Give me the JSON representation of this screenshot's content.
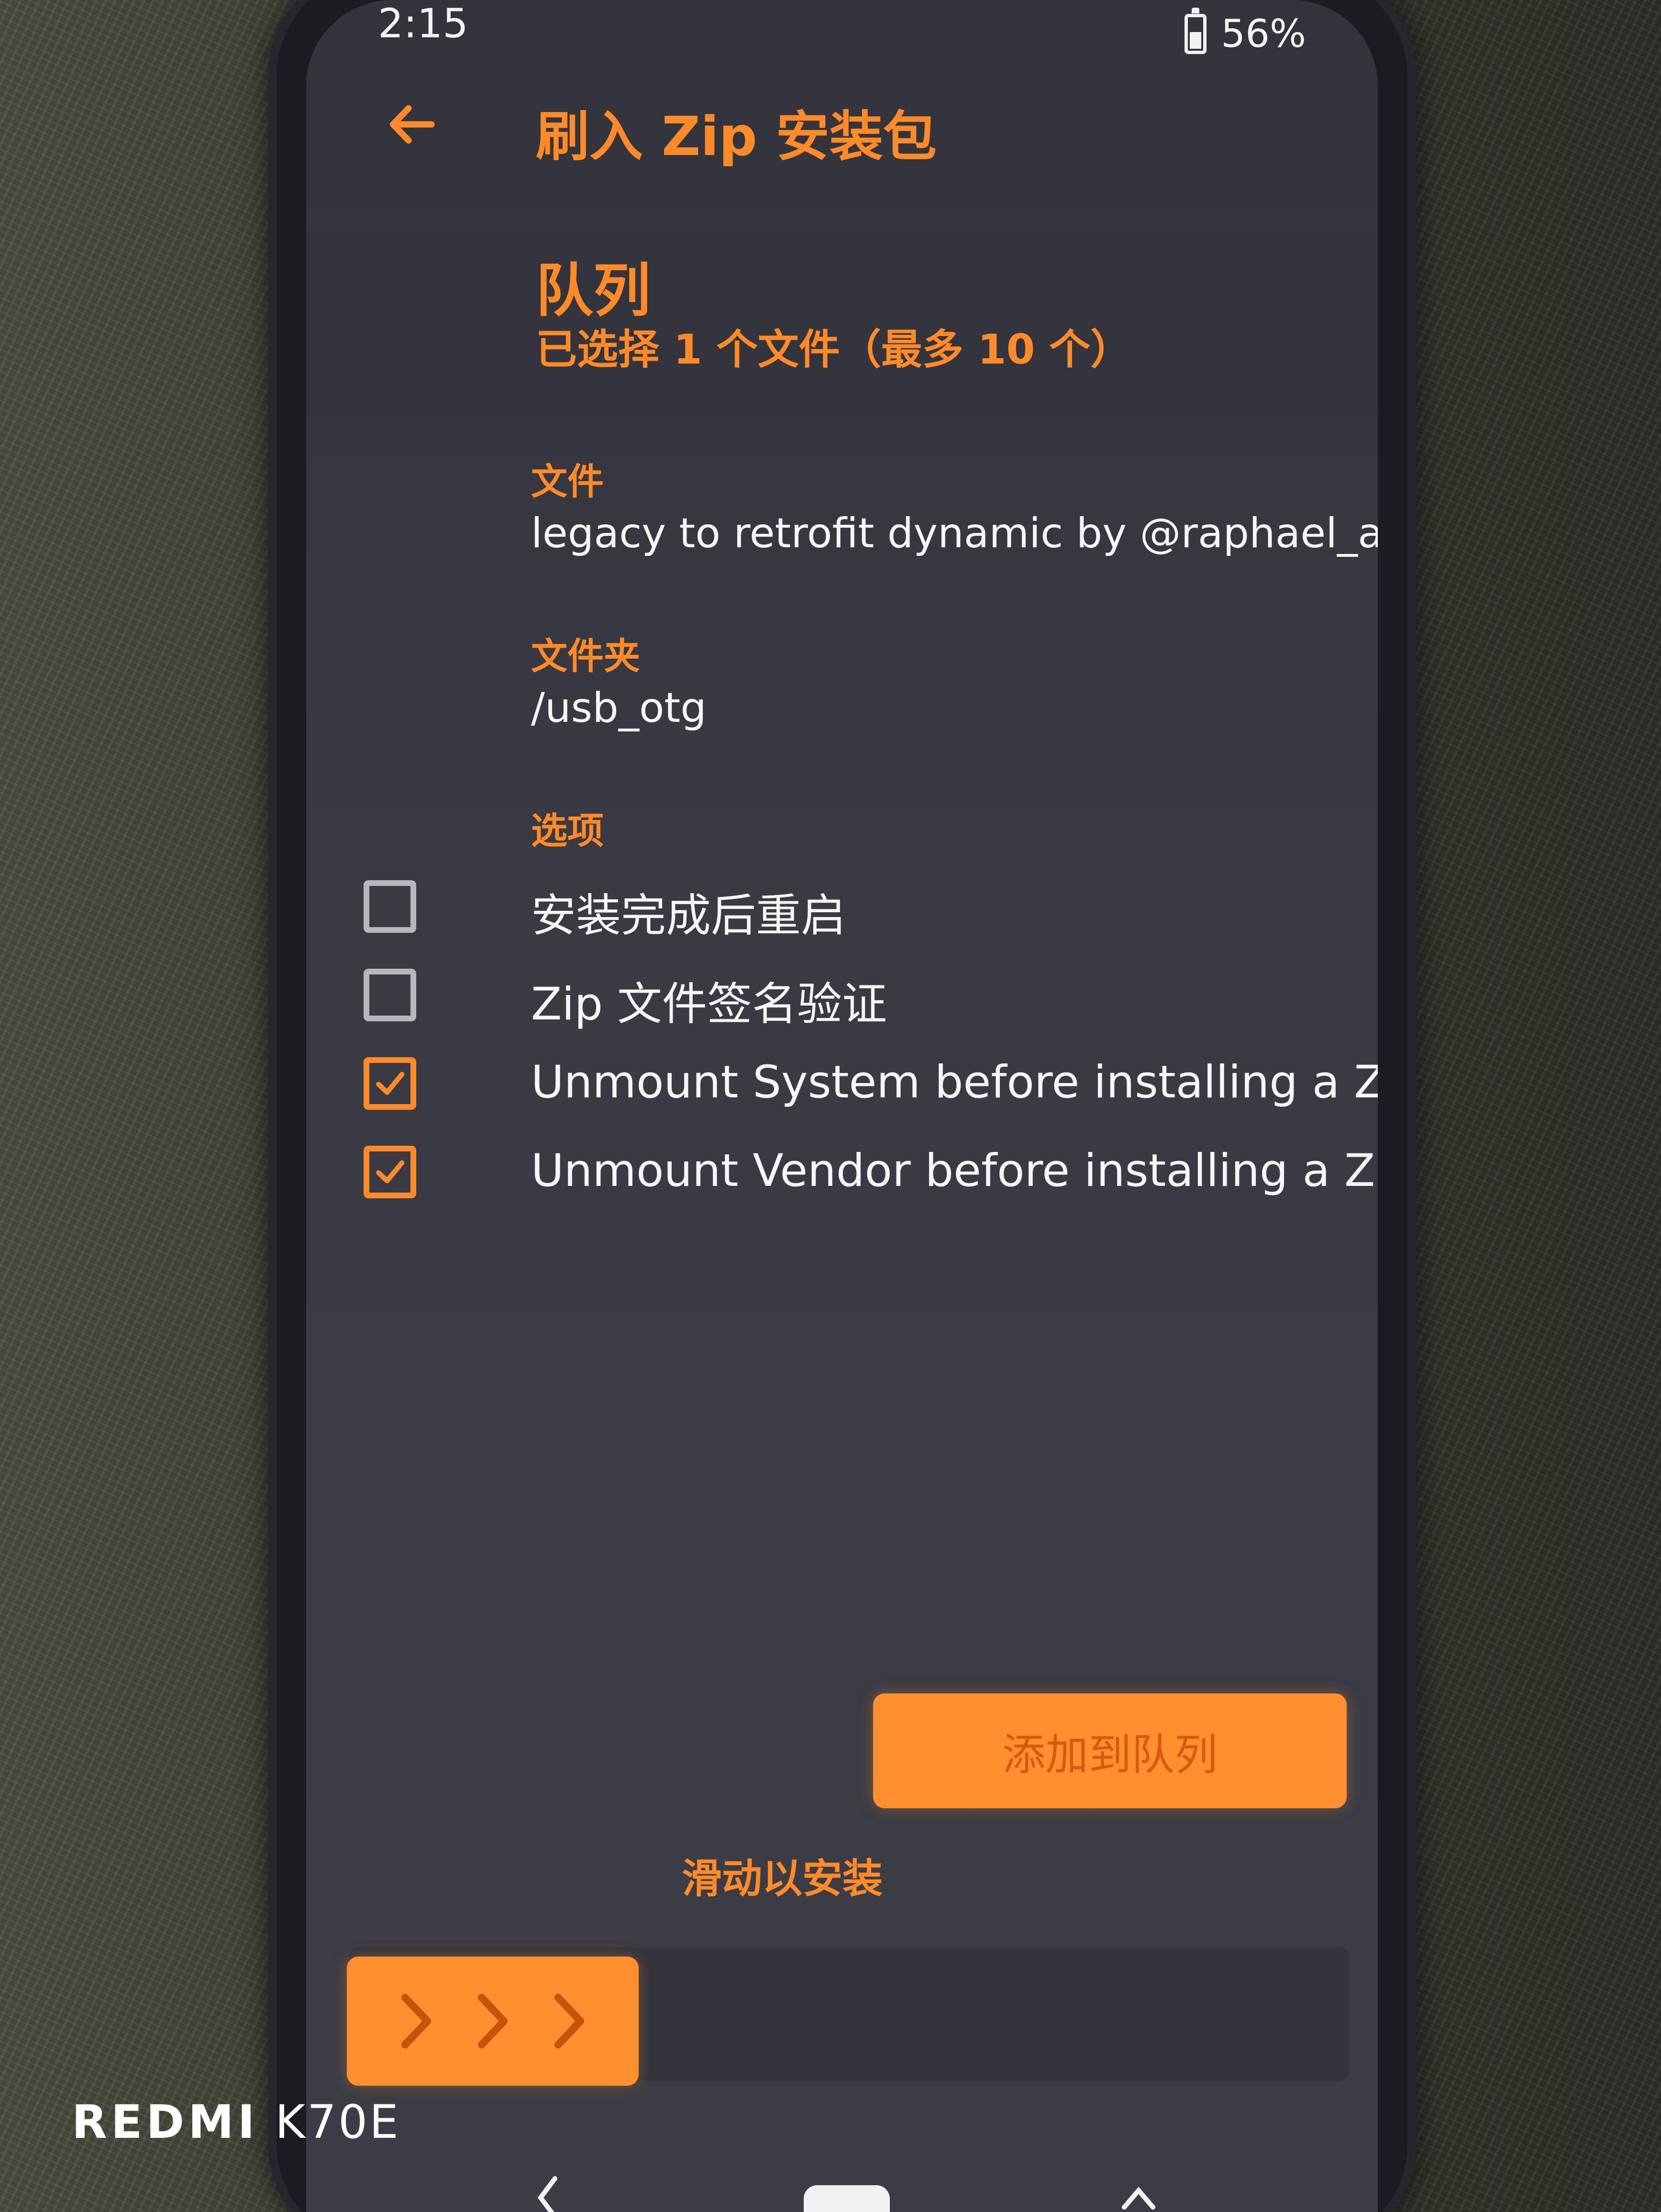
{
  "status_bar": {
    "time": "2:15",
    "battery": "56%",
    "battery_level": 0.56
  },
  "header": {
    "title": "刷入 Zip 安装包",
    "back_icon": "back-arrow-icon"
  },
  "queue": {
    "title": "队列",
    "subtitle": "已选择 1 个文件（最多 10 个）"
  },
  "file": {
    "label": "文件",
    "value": "legacy to retrofit dynamic by @raphael_alpha.zip"
  },
  "folder": {
    "label": "文件夹",
    "value": "/usb_otg"
  },
  "options": {
    "label": "选项",
    "items": [
      {
        "label": "安装完成后重启",
        "checked": false
      },
      {
        "label": "Zip 文件签名验证",
        "checked": false
      },
      {
        "label": "Unmount System before installing a ZIP",
        "checked": true
      },
      {
        "label": "Unmount Vendor before installing a ZIP",
        "checked": true
      }
    ]
  },
  "actions": {
    "add_to_queue": "添加到队列",
    "swipe_hint": "滑动以安装"
  },
  "colors": {
    "accent": "#ff8a2a",
    "background": "#3a3a43",
    "text": "#f6f6f6"
  },
  "watermark": {
    "brand": "REDMI",
    "model": "K70E"
  }
}
